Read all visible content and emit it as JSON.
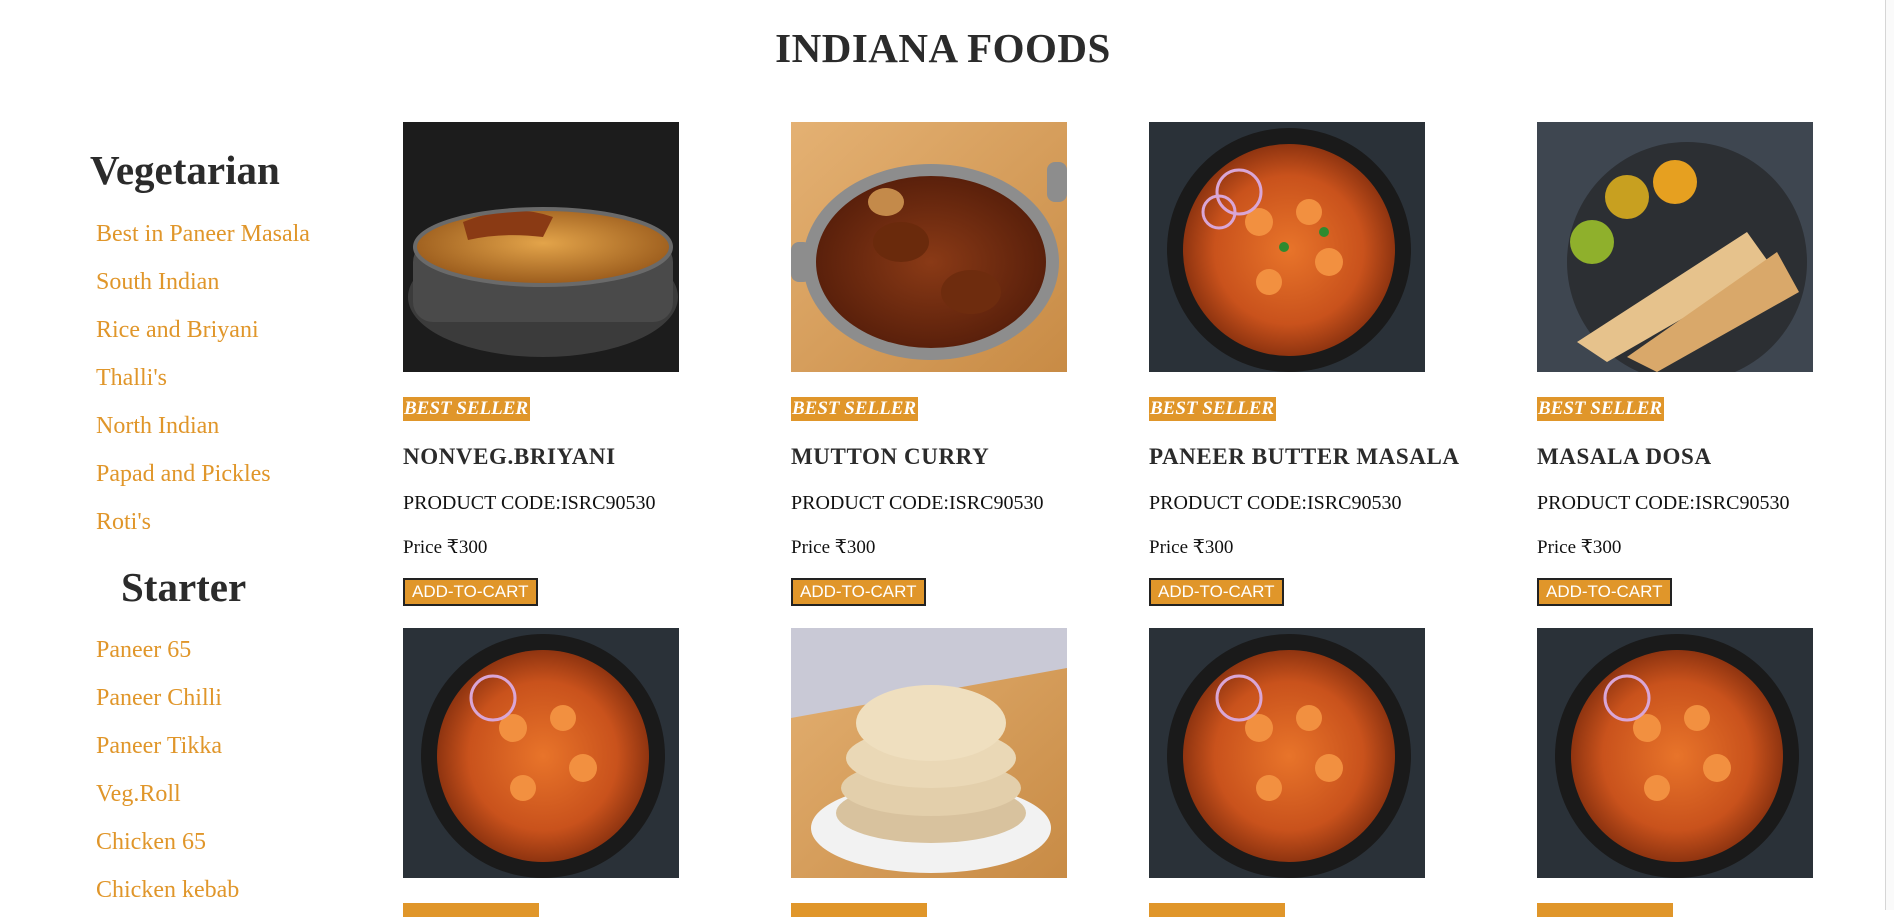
{
  "header": {
    "title": "INDIANA FOODS"
  },
  "sidebar": {
    "sections": [
      {
        "heading": "Vegetarian",
        "items": [
          "Best in Paneer Masala",
          "South Indian",
          "Rice and Briyani",
          "Thalli's",
          "North Indian",
          "Papad and Pickles",
          "Roti's"
        ]
      },
      {
        "heading": "Starter",
        "items": [
          "Paneer 65",
          "Paneer Chilli",
          "Paneer Tikka",
          "Veg.Roll",
          "Chicken 65",
          "Chicken kebab"
        ]
      }
    ]
  },
  "products": [
    {
      "badge": "BEST SELLER",
      "name": "NONVEG.BRIYANI",
      "code": "PRODUCT CODE:ISRC90530",
      "price": "Price ₹300",
      "button": "ADD-TO-CART",
      "image": "biryani-photo"
    },
    {
      "badge": "BEST SELLER",
      "name": "MUTTON CURRY",
      "code": "PRODUCT CODE:ISRC90530",
      "price": "Price ₹300",
      "button": "ADD-TO-CART",
      "image": "mutton-curry-photo"
    },
    {
      "badge": "BEST SELLER",
      "name": "PANEER BUTTER MASALA",
      "code": "PRODUCT CODE:ISRC90530",
      "price": "Price ₹300",
      "button": "ADD-TO-CART",
      "image": "paneer-masala-photo"
    },
    {
      "badge": "BEST SELLER",
      "name": "MASALA DOSA",
      "code": "PRODUCT CODE:ISRC90530",
      "price": "Price ₹300",
      "button": "ADD-TO-CART",
      "image": "masala-dosa-photo"
    }
  ],
  "second_row_images": [
    "paneer-masala-photo",
    "roti-stack-photo",
    "paneer-masala-photo",
    "paneer-masala-photo"
  ],
  "colors": {
    "accent": "#e0962a",
    "text": "#2b2b2b",
    "background": "#ffffff"
  }
}
